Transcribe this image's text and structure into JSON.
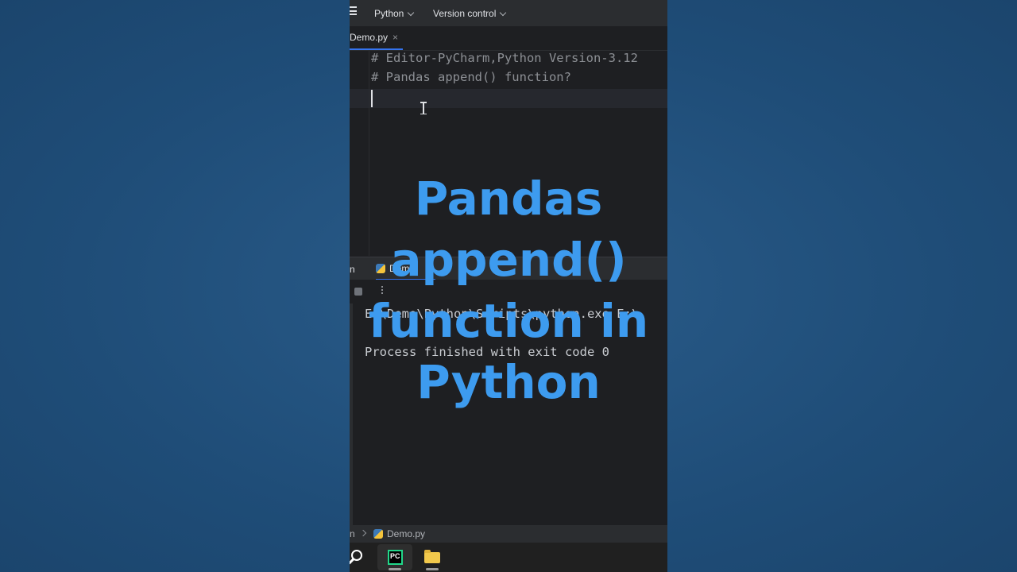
{
  "topbar": {
    "project_menu": "Python",
    "vcs_menu": "Version control"
  },
  "editor_tab": {
    "label": "Demo.py",
    "close": "×"
  },
  "editor": {
    "lines": [
      "# Editor-PyCharm,Python Version-3.12",
      "# Pandas append() function?"
    ]
  },
  "run_panel": {
    "left_label": "n",
    "tab_label": "Demo"
  },
  "console": {
    "lines": [
      "E:\\Demo\\Python\\Scripts\\python.exe E:\\",
      "Process finished with exit code 0"
    ]
  },
  "statusbar": {
    "left": "n",
    "file": "Demo.py"
  },
  "overlay": {
    "lines": [
      "Pandas",
      "append()",
      "function in",
      "Python"
    ],
    "color": "#3d9bef"
  },
  "icons": {
    "menu": "hamburger-icon",
    "close": "close-icon",
    "python": "python-file-icon",
    "stop": "stop-icon",
    "more": "kebab-icon",
    "search": "search-icon",
    "pycharm": "pycharm-icon",
    "explorer": "folder-icon"
  }
}
